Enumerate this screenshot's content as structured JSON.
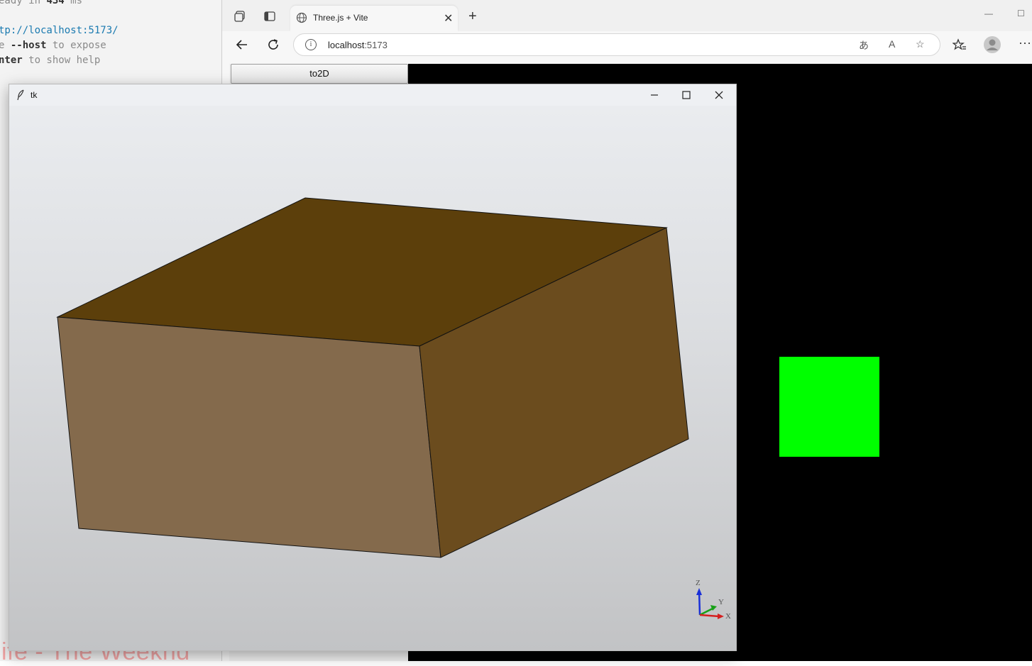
{
  "terminal": {
    "line1_prefix": "eady in ",
    "line1_time": "434",
    "line1_unit": " ms",
    "line2_url": "tp://localhost:5173/",
    "line3_prefix": "e ",
    "line3_flag": "--host",
    "line3_suffix": " to expose",
    "line4_key": "nter",
    "line4_suffix": " to show help",
    "watermark": "ife - The Weeknd"
  },
  "browser": {
    "tab_title": "Three.js + Vite",
    "url_host": "localhost",
    "url_port": ":5173",
    "page": {
      "button_label": "to2D",
      "square_color": "#00ff00",
      "background": "#000000"
    }
  },
  "tk_window": {
    "title": "tk",
    "axes": {
      "z_label": "Z",
      "y_label": "Y",
      "x_label": "X"
    },
    "box_colors": {
      "top": "#5c3f0b",
      "front": "#846a4c",
      "right": "#6b4c1e"
    },
    "axis_colors": {
      "x": "#d42020",
      "y": "#18a018",
      "z": "#1a30d8"
    }
  },
  "icons": [
    "workspaces-icon",
    "tab-actions-icon",
    "globe-icon",
    "close-icon",
    "new-tab-icon",
    "back-icon",
    "refresh-icon",
    "info-icon",
    "translate-icon",
    "read-aloud-icon",
    "favorite-icon",
    "favorites-icon",
    "profile-icon",
    "more-icon",
    "feather-icon",
    "minimize-icon",
    "maximize-icon"
  ]
}
